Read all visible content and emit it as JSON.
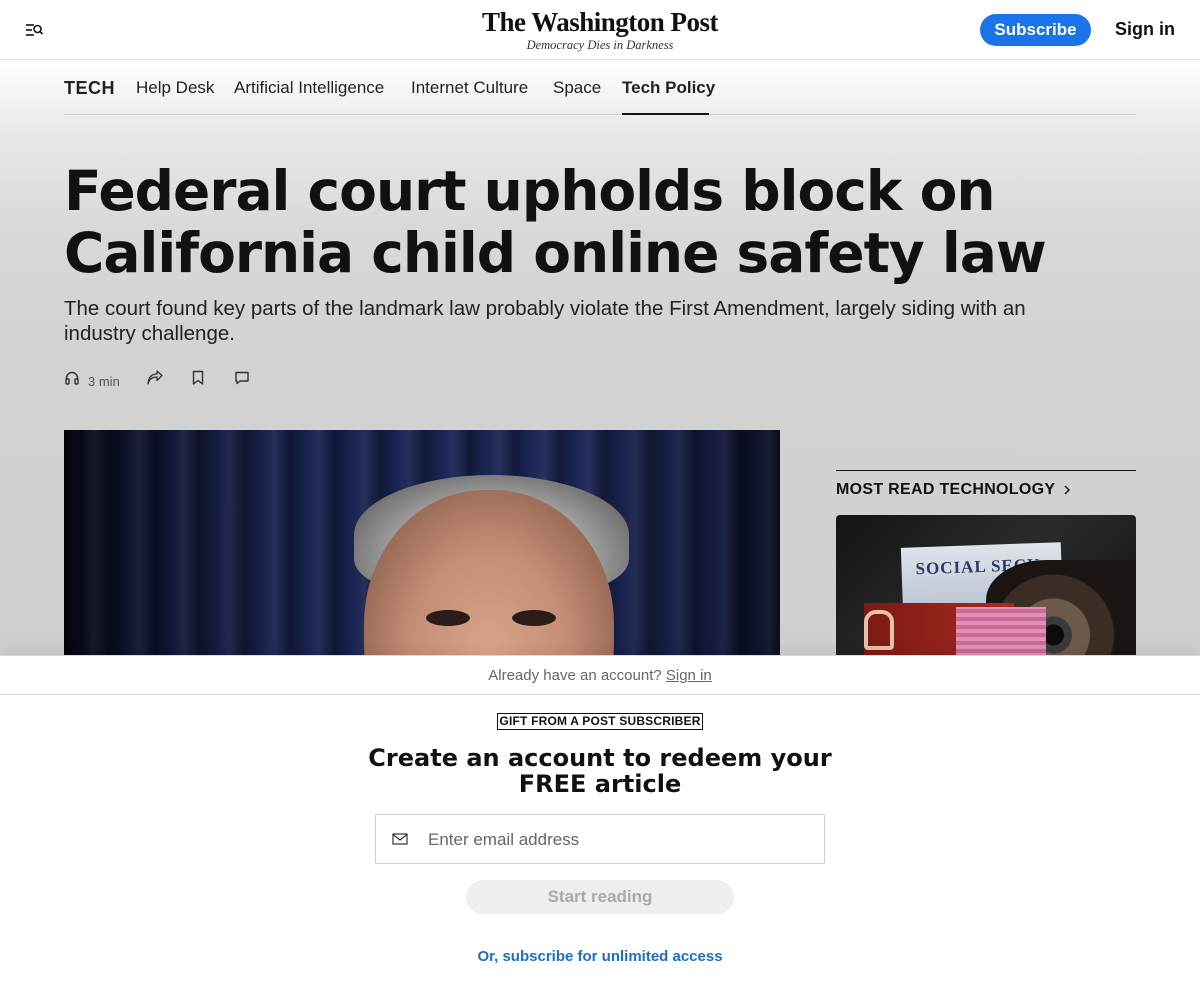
{
  "header": {
    "logo": "The Washington Post",
    "tagline": "Democracy Dies in Darkness",
    "subscribe_label": "Subscribe",
    "signin_label": "Sign in"
  },
  "section_nav": {
    "section": "TECH",
    "items": [
      {
        "label": "Help Desk"
      },
      {
        "label": "Artificial Intelligence"
      },
      {
        "label": "Internet Culture"
      },
      {
        "label": "Space"
      },
      {
        "label": "Tech Policy",
        "active": true
      }
    ]
  },
  "article": {
    "headline_line1": "Federal court upholds block on",
    "headline_line2": "California child online safety law",
    "dek": "The court found key parts of the landmark law probably violate the First Amendment, largely siding with an industry challenge.",
    "listen_time": "3 min"
  },
  "sidebar": {
    "most_read_title": "MOST READ TECHNOLOGY",
    "card_image_text": "SOCIAL SECU"
  },
  "paywall": {
    "already_text": "Already have an account?",
    "signin_link": "Sign in",
    "gift_badge": "GIFT FROM A POST SUBSCRIBER",
    "title_line1": "Create an account to redeem your",
    "title_line2": "FREE article",
    "email_placeholder": "Enter email address",
    "start_label": "Start reading",
    "subscribe_link": "Or, subscribe for unlimited access"
  },
  "colors": {
    "accent": "#1a73e8",
    "link": "#1a6fc9"
  }
}
